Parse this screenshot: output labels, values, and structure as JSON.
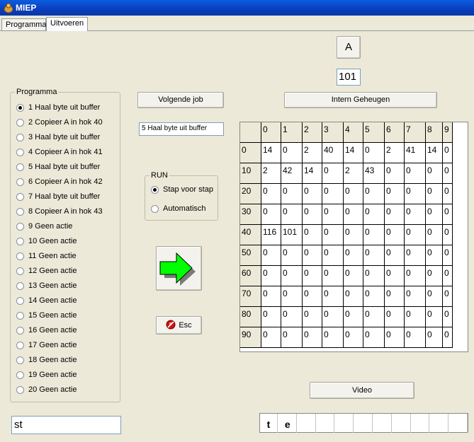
{
  "window": {
    "title": "MIEP"
  },
  "tabs": [
    {
      "label": "Programma"
    },
    {
      "label": "Uitvoeren"
    }
  ],
  "register": {
    "label": "A",
    "value": "101"
  },
  "buttons": {
    "volgende_job": "Volgende job",
    "intern_geheugen": "Intern Geheugen",
    "esc": "Esc",
    "video": "Video"
  },
  "current_job": "5  Haal byte uit buffer",
  "run": {
    "title": "RUN",
    "options": [
      {
        "label": "Stap voor stap",
        "selected": true
      },
      {
        "label": "Automatisch",
        "selected": false
      }
    ]
  },
  "programma": {
    "title": "Programma",
    "items": [
      {
        "label": "1  Haal byte uit buffer",
        "selected": true
      },
      {
        "label": "2  Copieer A in hok  40",
        "selected": false
      },
      {
        "label": "3  Haal byte uit buffer",
        "selected": false
      },
      {
        "label": "4  Copieer A in hok  41",
        "selected": false
      },
      {
        "label": "5  Haal byte uit buffer",
        "selected": false
      },
      {
        "label": "6  Copieer A in hok  42",
        "selected": false
      },
      {
        "label": "7  Haal byte uit buffer",
        "selected": false
      },
      {
        "label": "8  Copieer A in hok  43",
        "selected": false
      },
      {
        "label": "9  Geen actie",
        "selected": false
      },
      {
        "label": "10  Geen actie",
        "selected": false
      },
      {
        "label": "11  Geen actie",
        "selected": false
      },
      {
        "label": "12  Geen actie",
        "selected": false
      },
      {
        "label": "13  Geen actie",
        "selected": false
      },
      {
        "label": "14  Geen actie",
        "selected": false
      },
      {
        "label": "15  Geen actie",
        "selected": false
      },
      {
        "label": "16  Geen actie",
        "selected": false
      },
      {
        "label": "17  Geen actie",
        "selected": false
      },
      {
        "label": "18  Geen actie",
        "selected": false
      },
      {
        "label": "19  Geen actie",
        "selected": false
      },
      {
        "label": "20  Geen actie",
        "selected": false
      }
    ]
  },
  "memory": {
    "col_headers": [
      "0",
      "1",
      "2",
      "3",
      "4",
      "5",
      "6",
      "7",
      "8",
      "9"
    ],
    "rows": [
      {
        "label": "0",
        "values": [
          "14",
          "0",
          "2",
          "40",
          "14",
          "0",
          "2",
          "41",
          "14",
          "0"
        ]
      },
      {
        "label": "10",
        "values": [
          "2",
          "42",
          "14",
          "0",
          "2",
          "43",
          "0",
          "0",
          "0",
          "0"
        ]
      },
      {
        "label": "20",
        "values": [
          "0",
          "0",
          "0",
          "0",
          "0",
          "0",
          "0",
          "0",
          "0",
          "0"
        ]
      },
      {
        "label": "30",
        "values": [
          "0",
          "0",
          "0",
          "0",
          "0",
          "0",
          "0",
          "0",
          "0",
          "0"
        ]
      },
      {
        "label": "40",
        "values": [
          "116",
          "101",
          "0",
          "0",
          "0",
          "0",
          "0",
          "0",
          "0",
          "0"
        ]
      },
      {
        "label": "50",
        "values": [
          "0",
          "0",
          "0",
          "0",
          "0",
          "0",
          "0",
          "0",
          "0",
          "0"
        ]
      },
      {
        "label": "60",
        "values": [
          "0",
          "0",
          "0",
          "0",
          "0",
          "0",
          "0",
          "0",
          "0",
          "0"
        ]
      },
      {
        "label": "70",
        "values": [
          "0",
          "0",
          "0",
          "0",
          "0",
          "0",
          "0",
          "0",
          "0",
          "0"
        ]
      },
      {
        "label": "80",
        "values": [
          "0",
          "0",
          "0",
          "0",
          "0",
          "0",
          "0",
          "0",
          "0",
          "0"
        ]
      },
      {
        "label": "90",
        "values": [
          "0",
          "0",
          "0",
          "0",
          "0",
          "0",
          "0",
          "0",
          "0",
          "0"
        ]
      }
    ]
  },
  "input_text": "st",
  "video_chars": [
    "t",
    "e",
    "",
    "",
    "",
    "",
    "",
    "",
    "",
    "",
    ""
  ],
  "icons": {
    "window": "app-icon",
    "next": "arrow-right-icon",
    "esc": "stop-icon"
  },
  "colors": {
    "arrow": "#00ff00",
    "titlebar": "#0a46d4"
  }
}
